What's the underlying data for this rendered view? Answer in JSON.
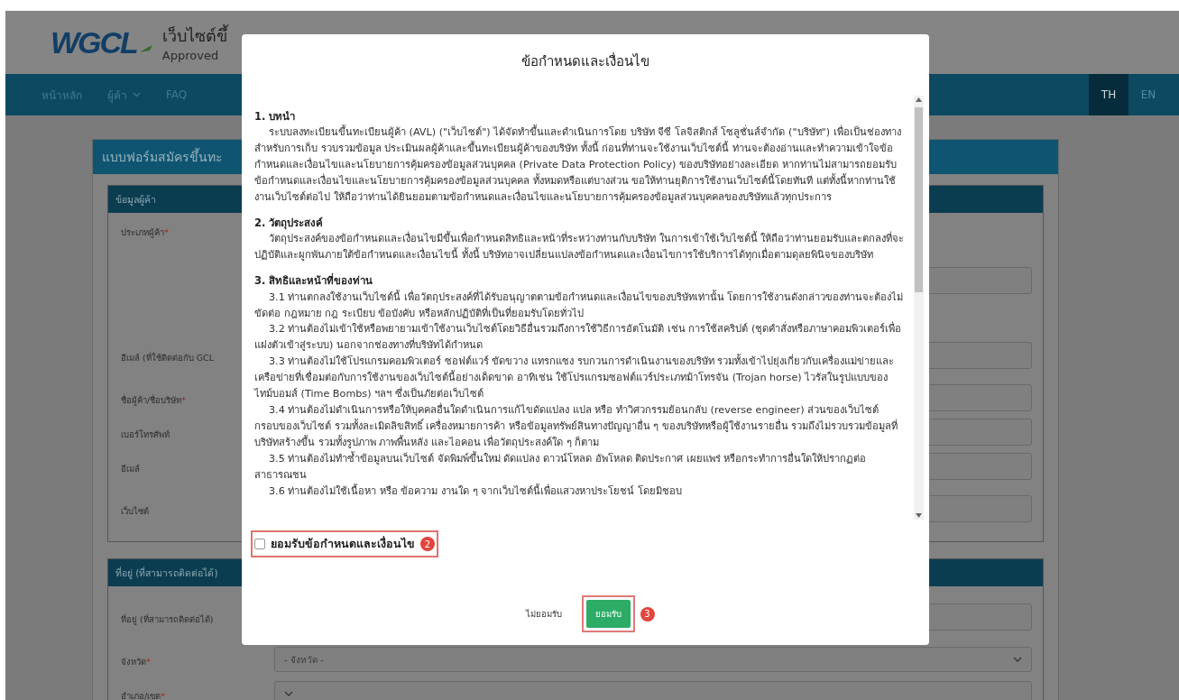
{
  "header": {
    "logo": "WGCL",
    "title": "เว็บไซต์ขึ้",
    "subtitle": "Approved"
  },
  "nav": {
    "items": [
      {
        "label": "หน้าหลัก",
        "kind": "link"
      },
      {
        "label": "ผู้ค้า",
        "kind": "dropdown"
      },
      {
        "label": "FAQ",
        "kind": "link"
      }
    ],
    "languages": [
      {
        "label": "TH",
        "selected": true
      },
      {
        "label": "EN",
        "selected": false
      }
    ]
  },
  "form": {
    "title": "แบบฟอร์มสมัครขึ้นทะ",
    "sections": [
      {
        "title": "ข้อมูลผู้ค้า",
        "fields": [
          {
            "label": "ประเภทผู้ค้า",
            "mark": "*",
            "kind": "choice"
          },
          {
            "label": "อีเมล์ (ที่ใช้ติดต่อกับ GCL",
            "kind": "text"
          },
          {
            "label": "ชื่อผู้ค้า/ชื่อบริษัท",
            "mark": "*",
            "kind": "short"
          },
          {
            "label": "เบอร์โทรศัพท์",
            "kind": "short"
          },
          {
            "label": "อีเมล์",
            "kind": "short"
          },
          {
            "label": "เว็บไซต์",
            "kind": "text"
          }
        ]
      },
      {
        "title": "ที่อยู่ (ที่สามารถติดต่อได้)",
        "fields": [
          {
            "label": "ที่อยู่ (ที่สามารถติดต่อได้)",
            "kind": "text"
          },
          {
            "label": "จังหวัด",
            "mark": "*",
            "kind": "select",
            "placeholder": "- จังหวัด -"
          },
          {
            "label": "อำเภอ/เขต",
            "mark": "*",
            "kind": "select"
          }
        ]
      }
    ]
  },
  "modal": {
    "title": "ข้อกำหนดและเงื่อนไข",
    "sections": [
      {
        "heading": "1. บทนำ",
        "paragraphs": [
          "ระบบลงทะเบียนขึ้นทะเบียนผู้ค้า (AVL) (\"เว็บไซต์\") ได้จัดทำขึ้นและดำเนินการโดย บริษัท จีซี โลจิสติกส์ โซลูชั่นส์จำกัด (\"บริษัท\") เพื่อเป็นช่องทางสำหรับการเก็บ รวบรวมข้อมูล ประเมินผลผู้ค้าและขึ้นทะเบียนผู้ค้าของบริษัท ทั้งนี้ ก่อนที่ท่านจะใช้งานเว็บไซต์นี้ ท่านจะต้องอ่านและทำความเข้าใจข้อกำหนดและเงื่อนไขและนโยบายการคุ้มครองข้อมูลส่วนบุคคล (Private Data Protection Policy) ของบริษัทอย่างละเอียด หากท่านไม่สามารถยอมรับข้อกำหนดและเงื่อนไขและนโยบายการคุ้มครองข้อมูลส่วนบุคคล ทั้งหมดหรือแต่บางส่วน ขอให้ท่านยุติการใช้งานเว็บไซต์นี้โดยทันที แต่ทั้งนี้หากท่านใช้งานเว็บไซต์ต่อไป ให้ถือว่าท่านได้ยินยอมตามข้อกำหนดและเงื่อนไขและนโยบายการคุ้มครองข้อมูลส่วนบุคคลของบริษัทแล้วทุกประการ"
        ]
      },
      {
        "heading": "2. วัตถุประสงค์",
        "paragraphs": [
          "วัตถุประสงค์ของข้อกำหนดและเงื่อนไขมีขึ้นเพื่อกำหนดสิทธิและหน้าที่ระหว่างท่านกับบริษัท ในการเข้าใช้เว็บไซต์นี้ ให้ถือว่าท่านยอมรับและตกลงที่จะปฏิบัติและผูกพันภายใต้ข้อกำหนดและเงื่อนไขนี้ ทั้งนี้ บริษัทอาจเปลี่ยนแปลงข้อกำหนดและเงื่อนไขการใช้บริการได้ทุกเมื่อตามดุลยพินิจของบริษัท"
        ]
      },
      {
        "heading": "3. สิทธิและหน้าที่ของท่าน",
        "paragraphs": [
          "3.1 ท่านตกลงใช้งานเว็บไซต์นี้ เพื่อวัตถุประสงค์ที่ได้รับอนุญาตตามข้อกำหนดและเงื่อนไขของบริษัทเท่านั้น โดยการใช้งานดังกล่าวของท่านจะต้องไม่ขัดต่อ กฎหมาย กฎ ระเบียบ ข้อบังคับ หรือหลักปฏิบัติที่เป็นที่ยอมรับโดยทั่วไป",
          "3.2 ท่านต้องไม่เข้าใช้หรือพยายามเข้าใช้งานเว็บไซต์โดยวิธีอื่นรวมถึงการใช้วิธีการอัตโนมัติ เช่น การใช้สคริปต์ (ชุดคำสั่งหรือภาษาคอมพิวเตอร์เพื่อแฝงตัวเข้าสู่ระบบ) นอกจากช่องทางที่บริษัทได้กำหนด",
          "3.3 ท่านต้องไม่ใช้โปรแกรมคอมพิวเตอร์ ซอฟต์แวร์ ขัดขวาง แทรกแซง รบกวนการดำเนินงานของบริษัท รวมทั้งเข้าไปยุ่งเกี่ยวกับเครื่องแม่ข่ายและเครือข่ายที่เชื่อมต่อกับการใช้งานของเว็บไซต์นี้อย่างเด็ดขาด อาทิเช่น ใช้โปรแกรมซอฟต์แวร์ประเภทม้าโทรจัน (Trojan horse) ไวรัสในรูปแบบของไทม์บอมส์ (Time Bombs) ฯลฯ ซึ่งเป็นภัยต่อเว็บไซต์",
          "3.4 ท่านต้องไม่ดำเนินการหรือให้บุคคลอื่นใดดำเนินการแก้ไขดัดแปลง แปล หรือ ทำวิศวกรรมย้อนกลับ (reverse engineer) ส่วนของเว็บไซต์ กรอบของเว็บไซต์ รวมทั้งละเมิดลิขสิทธิ์ เครื่องหมายการค้า หรือข้อมูลทรัพย์สินทางปัญญาอื่น ๆ ของบริษัทหรือผู้ใช้งานรายอื่น รวมถึงไม่รวบรวมข้อมูลที่บริษัทสร้างขึ้น รวมทั้งรูปภาพ ภาพพื้นหลัง และไอคอน เพื่อวัตถุประสงค์ใด ๆ ก็ตาม",
          "3.5 ท่านต้องไม่ทำซ้ำข้อมูลบนเว็บไซต์ จัดพิมพ์ขึ้นใหม่ ดัดแปลง ดาวน์โหลด อัพโหลด ติดประกาศ เผยแพร่ หรือกระทำการอื่นใดให้ปรากฏต่อสาธารณชน",
          "3.6 ท่านต้องไม่ใช้เนื้อหา หรือ ข้อความ งานใด ๆ จากเว็บไซต์นี้เพื่อแสวงหาประโยชน์ โดยมิชอบ"
        ]
      }
    ],
    "agree": {
      "label": "ยอมรับข้อกำหนดและเงื่อนไข",
      "checked": false,
      "step": "2"
    },
    "buttons": [
      {
        "label": "ไม่ยอมรับ",
        "kind": "secondary"
      },
      {
        "label": "ยอมรับ",
        "kind": "primary",
        "step": "3"
      }
    ]
  }
}
